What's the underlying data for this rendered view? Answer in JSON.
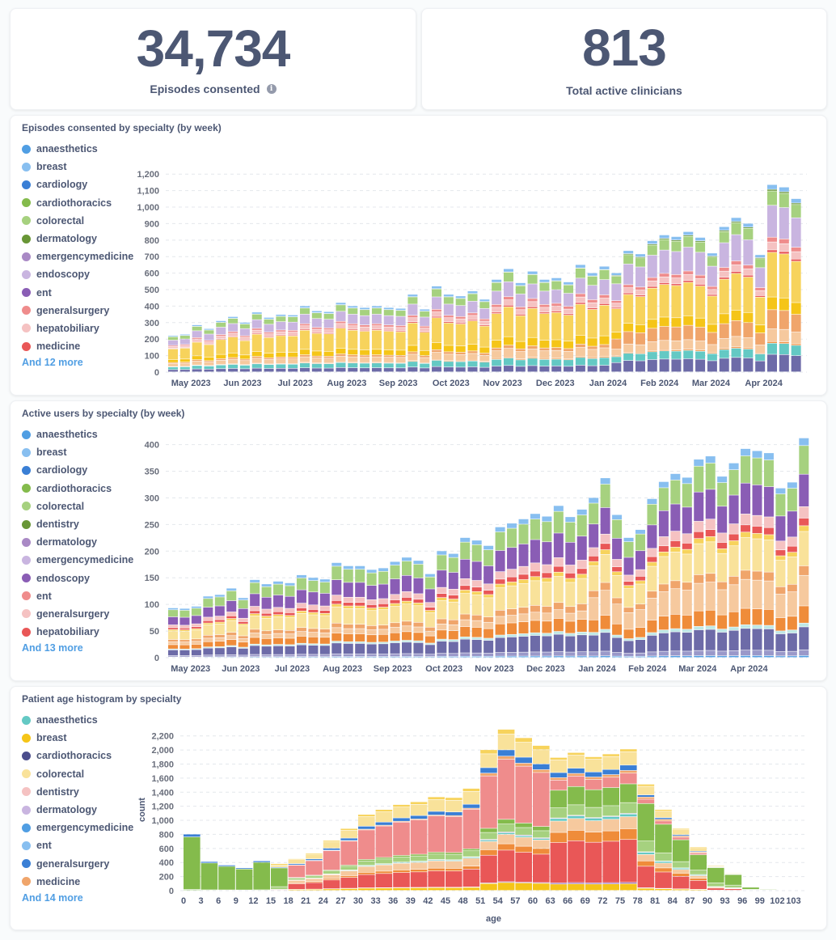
{
  "kpis": [
    {
      "value": "34,734",
      "label": "Episodes consented",
      "has_info": true
    },
    {
      "value": "813",
      "label": "Total active clinicians",
      "has_info": false
    }
  ],
  "chart_data": [
    {
      "type": "bar",
      "stacked": true,
      "title": "Episodes consented by specialty (by week)",
      "xlabel": "",
      "ylabel": "",
      "ylim": [
        0,
        1260
      ],
      "yticks": [
        0,
        100,
        200,
        300,
        400,
        500,
        600,
        700,
        800,
        900,
        1000,
        1100,
        1200
      ],
      "ytick_labels": [
        "0",
        "100",
        "200",
        "300",
        "400",
        "500",
        "600",
        "700",
        "800",
        "900",
        "1,000",
        "1,100",
        "1,200"
      ],
      "grid": true,
      "legend": {
        "position": "left",
        "items": [
          {
            "name": "anaesthetics",
            "color": "#509ee3"
          },
          {
            "name": "breast",
            "color": "#88bff0"
          },
          {
            "name": "cardiology",
            "color": "#3a7fd5"
          },
          {
            "name": "cardiothoracics",
            "color": "#84bb4c"
          },
          {
            "name": "colorectal",
            "color": "#a6d17f"
          },
          {
            "name": "dermatology",
            "color": "#689636"
          },
          {
            "name": "emergencymedicine",
            "color": "#a989c5"
          },
          {
            "name": "endoscopy",
            "color": "#c9b5e0"
          },
          {
            "name": "ent",
            "color": "#8a5db5"
          },
          {
            "name": "generalsurgery",
            "color": "#ef8c8c"
          },
          {
            "name": "hepatobiliary",
            "color": "#f5c2c2"
          },
          {
            "name": "medicine",
            "color": "#e95757"
          }
        ],
        "more_label": "And 12 more"
      },
      "x_tick_labels": [
        "May 2023",
        "Jun 2023",
        "Jul 2023",
        "Aug 2023",
        "Sep 2023",
        "Oct 2023",
        "Nov 2023",
        "Dec 2023",
        "Jan 2024",
        "Feb 2024",
        "Mar 2024",
        "Apr 2024"
      ],
      "x_tick_positions": [
        1.5,
        5.8,
        10.2,
        14.5,
        18.8,
        23.2,
        27.5,
        31.9,
        36.3,
        40.6,
        44.9,
        49.3
      ],
      "series_colors": [
        "#6d6ba8",
        "#64c9c4",
        "#ef8c3a",
        "#f6c99e",
        "#f0a56b",
        "#f5c518",
        "#f7d35c",
        "#e95757",
        "#f5c2c2",
        "#ef8c8c",
        "#c9b5e0",
        "#a6d17f",
        "#689636",
        "#88bff0"
      ],
      "totals": [
        220,
        228,
        285,
        262,
        310,
        335,
        300,
        362,
        330,
        348,
        345,
        400,
        370,
        365,
        420,
        400,
        390,
        400,
        390,
        385,
        470,
        380,
        520,
        470,
        460,
        490,
        440,
        560,
        625,
        540,
        610,
        560,
        570,
        545,
        650,
        600,
        640,
        600,
        735,
        715,
        795,
        830,
        820,
        850,
        815,
        720,
        880,
        935,
        900,
        710,
        1135,
        1120,
        1050
      ],
      "x_count": 53
    },
    {
      "type": "bar",
      "stacked": true,
      "title": "Active users by specialty (by week)",
      "xlabel": "",
      "ylabel": "",
      "ylim": [
        0,
        410
      ],
      "yticks": [
        0,
        50,
        100,
        150,
        200,
        250,
        300,
        350,
        400
      ],
      "ytick_labels": [
        "0",
        "50",
        "100",
        "150",
        "200",
        "250",
        "300",
        "350",
        "400"
      ],
      "grid": true,
      "legend": {
        "position": "left",
        "items": [
          {
            "name": "anaesthetics",
            "color": "#509ee3"
          },
          {
            "name": "breast",
            "color": "#88bff0"
          },
          {
            "name": "cardiology",
            "color": "#3a7fd5"
          },
          {
            "name": "cardiothoracics",
            "color": "#84bb4c"
          },
          {
            "name": "colorectal",
            "color": "#a6d17f"
          },
          {
            "name": "dentistry",
            "color": "#689636"
          },
          {
            "name": "dermatology",
            "color": "#a989c5"
          },
          {
            "name": "emergencymedicine",
            "color": "#c9b5e0"
          },
          {
            "name": "endoscopy",
            "color": "#8a5db5"
          },
          {
            "name": "ent",
            "color": "#ef8c8c"
          },
          {
            "name": "generalsurgery",
            "color": "#f5c2c2"
          },
          {
            "name": "hepatobiliary",
            "color": "#e95757"
          }
        ],
        "more_label": "And 13 more"
      },
      "x_tick_labels": [
        "May 2023",
        "Jun 2023",
        "Jul 2023",
        "Aug 2023",
        "Sep 2023",
        "Oct 2023",
        "Nov 2023",
        "Dec 2023",
        "Jan 2024",
        "Feb 2024",
        "Mar 2024",
        "Apr 2024"
      ],
      "x_tick_positions": [
        1.5,
        5.8,
        10.2,
        14.5,
        18.8,
        23.2,
        27.5,
        31.9,
        36.3,
        40.6,
        44.9,
        49.3
      ],
      "series_colors": [
        "#509ee3",
        "#9a98c9",
        "#6d6ba8",
        "#bfe8e6",
        "#ef8c3a",
        "#f6c99e",
        "#f0a56b",
        "#f9e29a",
        "#f7d35c",
        "#e95757",
        "#f5c2c2",
        "#8a5db5",
        "#a6d17f",
        "#88bff0"
      ],
      "totals": [
        93,
        92,
        96,
        115,
        118,
        130,
        112,
        146,
        138,
        143,
        140,
        155,
        150,
        147,
        178,
        172,
        172,
        165,
        168,
        180,
        188,
        182,
        157,
        200,
        195,
        225,
        220,
        210,
        245,
        252,
        260,
        270,
        265,
        285,
        264,
        278,
        300,
        337,
        268,
        225,
        240,
        298,
        330,
        345,
        338,
        372,
        378,
        340,
        365,
        392,
        388,
        384,
        318,
        329,
        412
      ],
      "x_count": 55
    },
    {
      "type": "bar",
      "stacked": true,
      "histogram": true,
      "title": "Patient age histogram by specialty",
      "xlabel": "age",
      "ylabel": "count",
      "ylim": [
        0,
        2300
      ],
      "yticks": [
        0,
        200,
        400,
        600,
        800,
        1000,
        1200,
        1400,
        1600,
        1800,
        2000,
        2200
      ],
      "ytick_labels": [
        "0",
        "200",
        "400",
        "600",
        "800",
        "1,000",
        "1,200",
        "1,400",
        "1,600",
        "1,800",
        "2,000",
        "2,200"
      ],
      "grid": true,
      "legend": {
        "position": "left",
        "items": [
          {
            "name": "anaesthetics",
            "color": "#64c9c4"
          },
          {
            "name": "breast",
            "color": "#f5c518"
          },
          {
            "name": "cardiothoracics",
            "color": "#4b4d8c"
          },
          {
            "name": "colorectal",
            "color": "#f9e29a"
          },
          {
            "name": "dentistry",
            "color": "#f5c2c2"
          },
          {
            "name": "dermatology",
            "color": "#c9b5e0"
          },
          {
            "name": "emergencymedicine",
            "color": "#509ee3"
          },
          {
            "name": "ent",
            "color": "#88bff0"
          },
          {
            "name": "generalsurgery",
            "color": "#3a7fd5"
          },
          {
            "name": "medicine",
            "color": "#f0a56b"
          }
        ],
        "more_label": "And 14 more"
      },
      "categories": [
        "0",
        "3",
        "6",
        "9",
        "12",
        "15",
        "18",
        "21",
        "24",
        "27",
        "30",
        "33",
        "36",
        "39",
        "42",
        "45",
        "48",
        "51",
        "54",
        "57",
        "60",
        "63",
        "66",
        "69",
        "72",
        "75",
        "78",
        "81",
        "84",
        "87",
        "90",
        "93",
        "96",
        "99",
        "102"
      ],
      "x_tick_labels": [
        "0",
        "3",
        "6",
        "9",
        "12",
        "15",
        "18",
        "21",
        "24",
        "27",
        "30",
        "33",
        "36",
        "39",
        "42",
        "45",
        "48",
        "51",
        "54",
        "57",
        "60",
        "63",
        "66",
        "69",
        "72",
        "75",
        "78",
        "81",
        "84",
        "87",
        "90",
        "93",
        "96",
        "99",
        "102",
        "103"
      ],
      "series_colors": [
        "#f5c518",
        "#8a5db5",
        "#e95757",
        "#ef8c3a",
        "#f6c99e",
        "#64c9c4",
        "#a989c5",
        "#a6d17f",
        "#84bb4c",
        "#ef8c8c",
        "#f0a56b",
        "#3a7fd5",
        "#f9e29a",
        "#f7d35c"
      ],
      "totals": [
        800,
        410,
        360,
        320,
        420,
        380,
        450,
        530,
        710,
        880,
        1080,
        1150,
        1220,
        1260,
        1330,
        1320,
        1450,
        2000,
        2290,
        2170,
        2060,
        1890,
        1960,
        1900,
        1940,
        2010,
        1510,
        1150,
        880,
        620,
        360,
        250,
        50,
        15,
        10
      ],
      "green_base": [
        760,
        340,
        290,
        280,
        360,
        260
      ]
    }
  ]
}
